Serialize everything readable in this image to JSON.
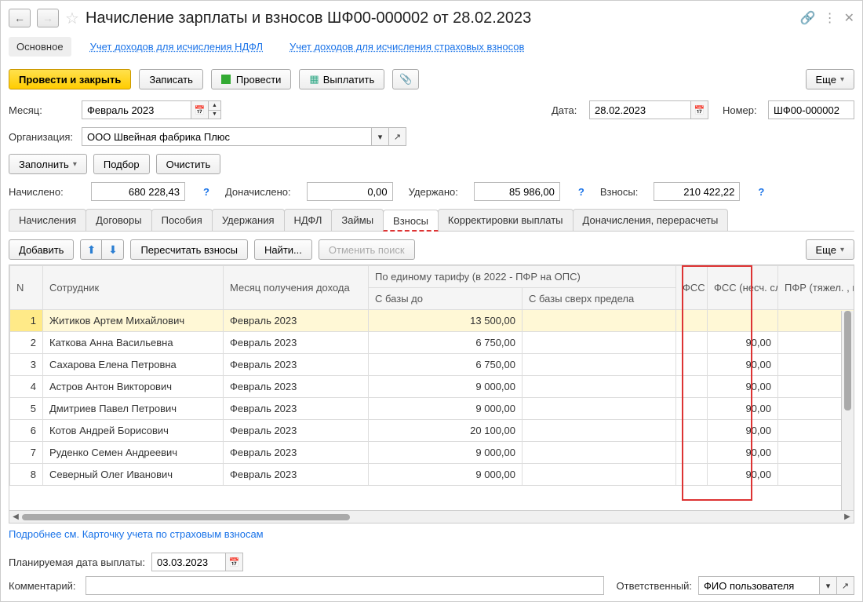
{
  "title": "Начисление зарплаты и взносов ШФ00-000002 от 28.02.2023",
  "nav_tabs": {
    "main": "Основное",
    "ndfl": "Учет доходов для исчисления НДФЛ",
    "insurance": "Учет доходов для исчисления страховых взносов"
  },
  "cmd": {
    "post_close": "Провести и закрыть",
    "save": "Записать",
    "post": "Провести",
    "pay": "Выплатить",
    "more": "Еще"
  },
  "fields": {
    "month_label": "Месяц:",
    "month": "Февраль 2023",
    "date_label": "Дата:",
    "date": "28.02.2023",
    "number_label": "Номер:",
    "number": "ШФ00-000002",
    "org_label": "Организация:",
    "org": "ООО Швейная фабрика Плюс",
    "fill": "Заполнить",
    "select": "Подбор",
    "clear": "Очистить"
  },
  "totals": {
    "accrued_label": "Начислено:",
    "accrued": "680 228,43",
    "add_accrued_label": "Доначислено:",
    "add_accrued": "0,00",
    "withheld_label": "Удержано:",
    "withheld": "85 986,00",
    "contrib_label": "Взносы:",
    "contrib": "210 422,22"
  },
  "tabs": [
    "Начисления",
    "Договоры",
    "Пособия",
    "Удержания",
    "НДФЛ",
    "Займы",
    "Взносы",
    "Корректировки выплаты",
    "Доначисления, перерасчеты"
  ],
  "active_tab": 6,
  "sub": {
    "add": "Добавить",
    "recalc": "Пересчитать взносы",
    "find": "Найти...",
    "cancel_find": "Отменить поиск",
    "more": "Еще"
  },
  "grid": {
    "headers": {
      "n": "N",
      "emp": "Сотрудник",
      "month": "Месяц получения дохода",
      "tarif": "По единому тарифу (в 2022 - ПФР на ОПС)",
      "tarif1": "С базы до",
      "tarif2": "С базы сверх предела",
      "fss": "ФСС",
      "fssn": "ФСС (несч. случ.)",
      "pfr": "ПФР (тяжел. , кл."
    },
    "rows": [
      {
        "n": 1,
        "emp": "Житиков Артем Михайлович",
        "month": "Февраль 2023",
        "t1": "13 500,00",
        "t2": "",
        "fssn": ""
      },
      {
        "n": 2,
        "emp": "Каткова Анна Васильевна",
        "month": "Февраль 2023",
        "t1": "6 750,00",
        "t2": "",
        "fssn": "90,00"
      },
      {
        "n": 3,
        "emp": "Сахарова Елена Петровна",
        "month": "Февраль 2023",
        "t1": "6 750,00",
        "t2": "",
        "fssn": "90,00"
      },
      {
        "n": 4,
        "emp": "Астров Антон Викторович",
        "month": "Февраль 2023",
        "t1": "9 000,00",
        "t2": "",
        "fssn": "90,00"
      },
      {
        "n": 5,
        "emp": "Дмитриев Павел Петрович",
        "month": "Февраль 2023",
        "t1": "9 000,00",
        "t2": "",
        "fssn": "90,00"
      },
      {
        "n": 6,
        "emp": "Котов Андрей Борисович",
        "month": "Февраль 2023",
        "t1": "20 100,00",
        "t2": "",
        "fssn": "90,00"
      },
      {
        "n": 7,
        "emp": "Руденко Семен Андреевич",
        "month": "Февраль 2023",
        "t1": "9 000,00",
        "t2": "",
        "fssn": "90,00"
      },
      {
        "n": 8,
        "emp": "Северный Олег Иванович",
        "month": "Февраль 2023",
        "t1": "9 000,00",
        "t2": "",
        "fssn": "90,00"
      }
    ]
  },
  "link_more": "Подробнее см. Карточку учета по страховым взносам",
  "footer": {
    "plan_date_label": "Планируемая дата выплаты:",
    "plan_date": "03.03.2023",
    "comment_label": "Комментарий:",
    "comment": "",
    "resp_label": "Ответственный:",
    "resp": "ФИО пользователя"
  }
}
